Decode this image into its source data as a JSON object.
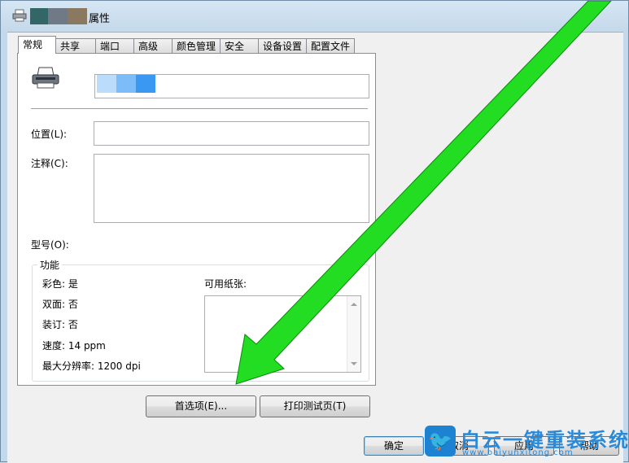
{
  "window": {
    "title_suffix": "属性",
    "title_redaction_colors": [
      "#336666",
      "#707a86",
      "#8a7860"
    ]
  },
  "tabs": [
    {
      "label": "常规",
      "active": true
    },
    {
      "label": "共享",
      "active": false
    },
    {
      "label": "端口",
      "active": false
    },
    {
      "label": "高级",
      "active": false
    },
    {
      "label": "颜色管理",
      "active": false
    },
    {
      "label": "安全",
      "active": false
    },
    {
      "label": "设备设置",
      "active": false
    },
    {
      "label": "配置文件",
      "active": false
    }
  ],
  "general": {
    "printer_name_redaction_colors": [
      "#bcdcfb",
      "#7cbcf8",
      "#3a98f2"
    ],
    "location_label": "位置(L):",
    "location_value": "",
    "comment_label": "注释(C):",
    "comment_value": "",
    "model_label": "型号(O):",
    "model_value": ""
  },
  "features": {
    "title": "功能",
    "color": "彩色: 是",
    "duplex": "双面: 否",
    "staple": "装订: 否",
    "speed": "速度: 14 ppm",
    "max_resolution": "最大分辨率: 1200 dpi",
    "paper_label": "可用纸张:",
    "paper_items": []
  },
  "buttons": {
    "preferences": "首选项(E)...",
    "print_test_page": "打印测试页(T)",
    "ok": "确定",
    "cancel": "取消",
    "apply": "应用",
    "help": "帮助"
  },
  "annotation": {
    "arrow_color": "#22dd22"
  },
  "watermark": {
    "name": "白云一键重装系统",
    "url": "www.baiyunxitong.com"
  }
}
